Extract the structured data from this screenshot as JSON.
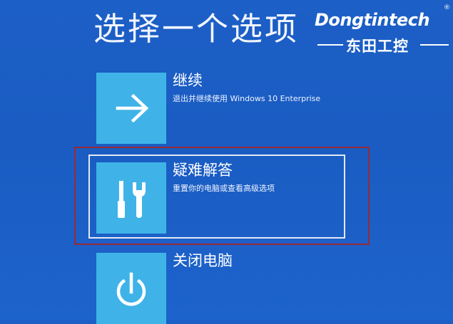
{
  "page": {
    "title": "选择一个选项"
  },
  "watermark": {
    "brand": "Dongtintech",
    "registered": "®",
    "subtitle": "东田工控"
  },
  "options": [
    {
      "title": "继续",
      "description": "退出并继续使用 Windows 10 Enterprise",
      "icon": "arrow-right-icon"
    },
    {
      "title": "疑难解答",
      "description": "重置你的电脑或查看高级选项",
      "icon": "tools-icon",
      "selected": true
    },
    {
      "title": "关闭电脑",
      "description": "",
      "icon": "power-icon"
    }
  ],
  "colors": {
    "background": "#1c5fc6",
    "tile": "#3fb3e8",
    "selection_border": "#e3e9f5",
    "highlight_border": "#9a2a36"
  }
}
